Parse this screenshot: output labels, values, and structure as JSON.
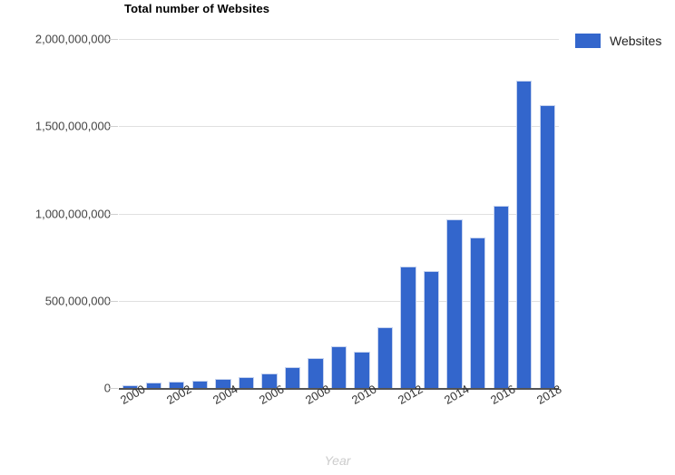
{
  "chart": {
    "title": "Total number of Websites",
    "x_axis_title": "Year",
    "legend_label": "Websites",
    "series_color": "#3366cc",
    "gridline_color": "#e0e0e0",
    "axis_color": "#545454"
  },
  "chart_data": {
    "type": "bar",
    "title": "Total number of Websites",
    "xlabel": "Year",
    "ylabel": "",
    "ylim": [
      0,
      2000000000
    ],
    "grid": true,
    "legend_position": "right",
    "categories": [
      "2000",
      "2001",
      "2002",
      "2003",
      "2004",
      "2005",
      "2006",
      "2007",
      "2008",
      "2009",
      "2010",
      "2011",
      "2012",
      "2013",
      "2014",
      "2015",
      "2016",
      "2017",
      "2018"
    ],
    "tick_labels_shown": [
      "2000",
      "2002",
      "2004",
      "2006",
      "2008",
      "2010",
      "2012",
      "2014",
      "2016",
      "2018"
    ],
    "y_tick_labels": [
      "0",
      "500,000,000",
      "1,000,000,000",
      "1,500,000,000",
      "2,000,000,000"
    ],
    "y_tick_values": [
      0,
      500000000,
      1000000000,
      1500000000,
      2000000000
    ],
    "series": [
      {
        "name": "Websites",
        "color": "#3366cc",
        "values": [
          17000000,
          29000000,
          38000000,
          40000000,
          51000000,
          64000000,
          85000000,
          121000000,
          172000000,
          238000000,
          206000000,
          346000000,
          697000000,
          672000000,
          968000000,
          863000000,
          1045000000,
          1760000000,
          1620000000
        ]
      }
    ]
  }
}
